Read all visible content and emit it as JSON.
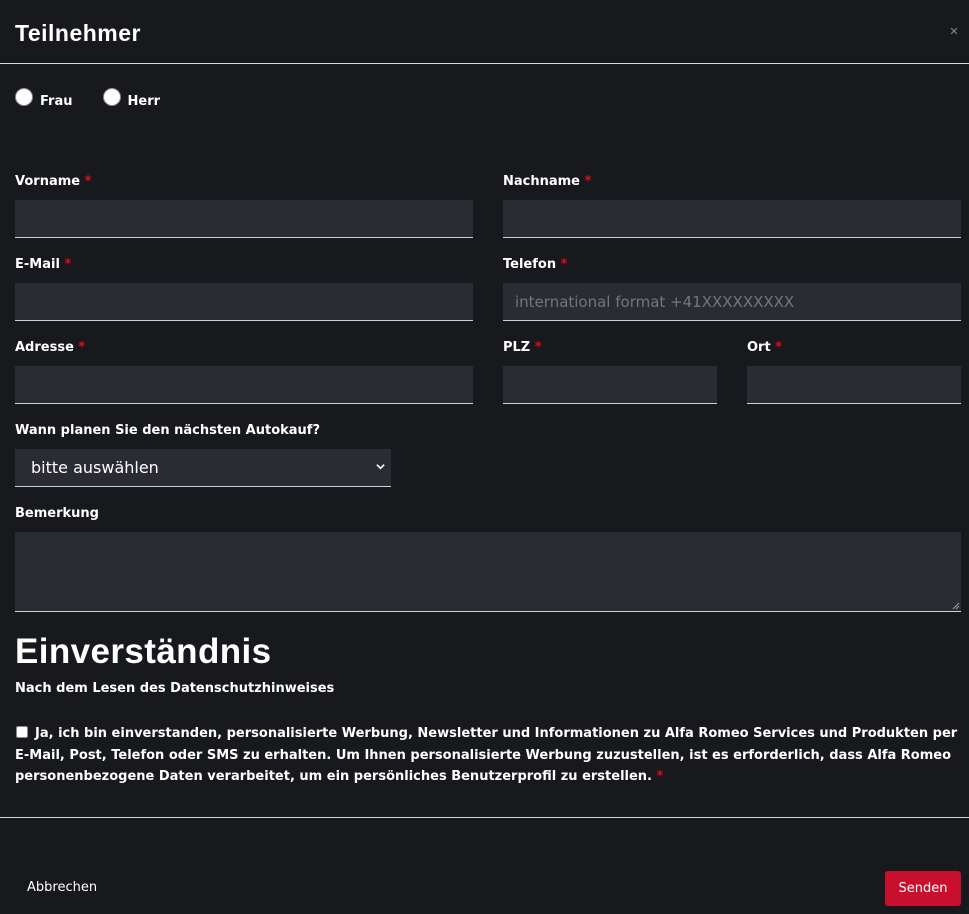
{
  "dialog": {
    "title": "Teilnehmer"
  },
  "salutation": {
    "options": [
      "Frau",
      "Herr"
    ]
  },
  "fields": {
    "vorname": {
      "label": "Vorname",
      "required": "*",
      "value": ""
    },
    "nachname": {
      "label": "Nachname",
      "required": "*",
      "value": ""
    },
    "email": {
      "label": "E-Mail",
      "required": "*",
      "value": ""
    },
    "telefon": {
      "label": "Telefon",
      "required": "*",
      "placeholder": "international format +41XXXXXXXXX",
      "value": ""
    },
    "adresse": {
      "label": "Adresse",
      "required": "*",
      "value": ""
    },
    "plz": {
      "label": "PLZ",
      "required": "*",
      "value": ""
    },
    "ort": {
      "label": "Ort",
      "required": "*",
      "value": ""
    },
    "autokauf": {
      "label": "Wann planen Sie den nächsten Autokauf?",
      "selected": "bitte auswählen"
    },
    "bemerkung": {
      "label": "Bemerkung",
      "value": ""
    }
  },
  "consent": {
    "title": "Einverständnis",
    "subtitle": "Nach dem Lesen des Datenschutzhinweises",
    "text": "Ja, ich bin einverstanden, personalisierte Werbung, Newsletter und Informationen zu Alfa Romeo Services und Produkten per E-Mail, Post, Telefon oder SMS zu erhalten. Um Ihnen personalisierte Werbung zuzustellen, ist es erforderlich, dass Alfa Romeo personenbezogene Daten verarbeitet, um ein persönliches Benutzerprofil zu erstellen.",
    "required": "*"
  },
  "footer": {
    "cancel_label": "Abbrechen",
    "submit_label": "Senden"
  },
  "colors": {
    "background": "#18191d",
    "input": "#2a2b33",
    "required": "#e30b17",
    "primary_button": "#c8102e"
  },
  "icons": {
    "close": "close-icon",
    "select_chevron": "chevron-down-icon"
  }
}
